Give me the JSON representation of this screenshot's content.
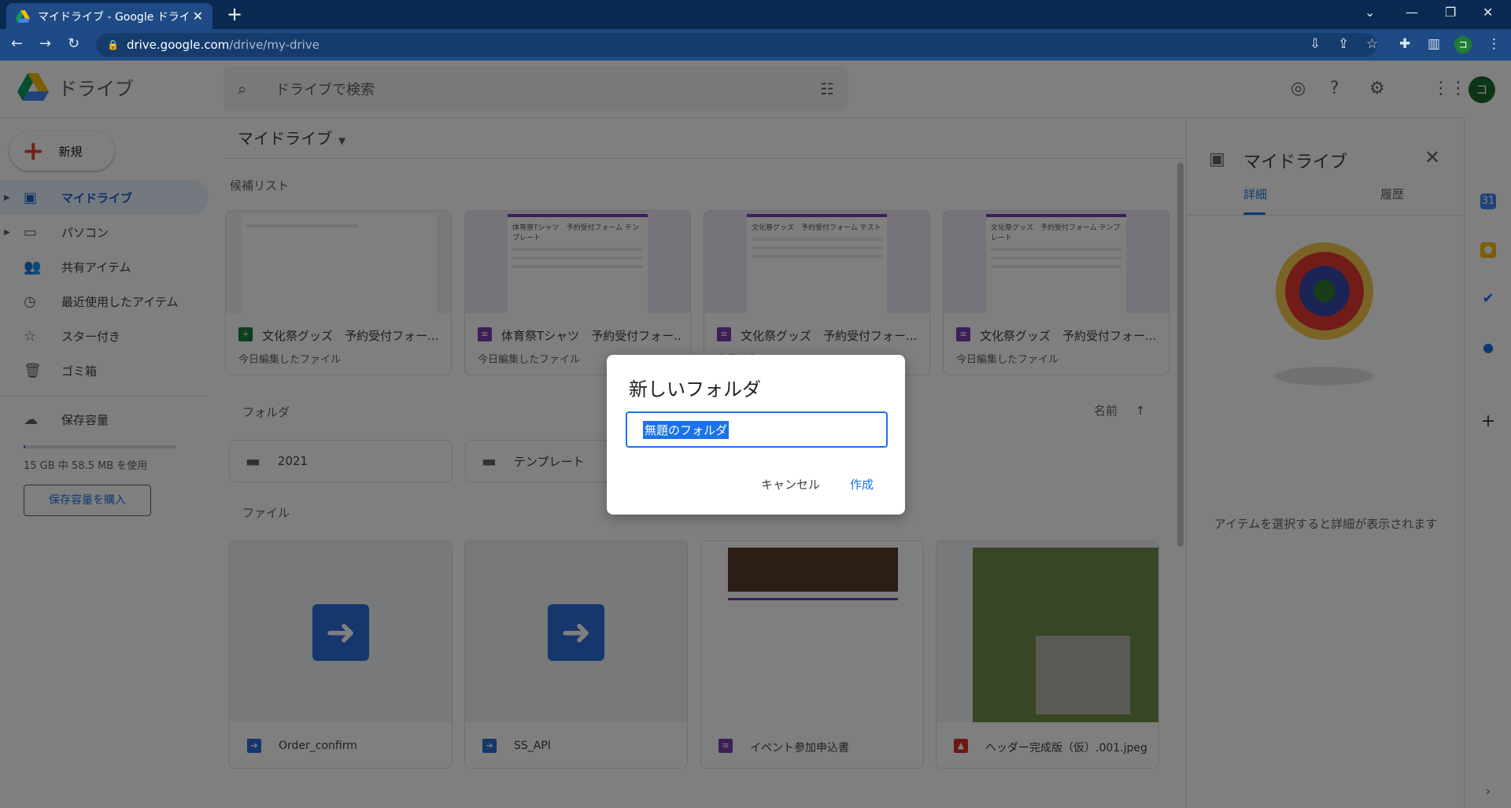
{
  "browser": {
    "tab_title": "マイドライブ - Google ドライブ",
    "url_host": "drive.google.com",
    "url_path": "/drive/my-drive",
    "profile_initial": "コ"
  },
  "header": {
    "app_name": "ドライブ",
    "search_placeholder": "ドライブで検索",
    "avatar_initial": "コ"
  },
  "sidebar": {
    "new_label": "新規",
    "items": [
      {
        "label": "マイドライブ",
        "icon": "drive-icon"
      },
      {
        "label": "パソコン",
        "icon": "computer-icon"
      },
      {
        "label": "共有アイテム",
        "icon": "people-icon"
      },
      {
        "label": "最近使用したアイテム",
        "icon": "clock-icon"
      },
      {
        "label": "スター付き",
        "icon": "star-icon"
      },
      {
        "label": "ゴミ箱",
        "icon": "trash-icon"
      }
    ],
    "storage_label": "保存容量",
    "storage_used_text": "15 GB 中 58.5 MB を使用",
    "storage_fraction": 0.004,
    "buy_storage_label": "保存容量を購入"
  },
  "main": {
    "breadcrumb": "マイドライブ",
    "suggested_label": "候補リスト",
    "suggested": [
      {
        "title": "文化祭グッズ　予約受付フォー...",
        "sub": "今日編集したファイル",
        "type": "sheets",
        "doc_title": ""
      },
      {
        "title": "体育祭Tシャツ　予約受付フォー...",
        "sub": "今日編集したファイル",
        "type": "forms",
        "doc_title": "体育祭Tシャツ　予約受付フォーム テンプレート"
      },
      {
        "title": "文化祭グッズ　予約受付フォー...",
        "sub": "今日編集したファイル",
        "type": "forms",
        "doc_title": "文化祭グッズ　予約受付フォーム テスト"
      },
      {
        "title": "文化祭グッズ　予約受付フォー...",
        "sub": "今日編集したファイル",
        "type": "forms",
        "doc_title": "文化祭グッズ　予約受付フォーム テンプレート"
      }
    ],
    "folders_label": "フォルダ",
    "sort_label": "名前",
    "folders": [
      {
        "name": "2021"
      },
      {
        "name": "テンプレート"
      }
    ],
    "files_label": "ファイル",
    "files": [
      {
        "name": "Order_confirm",
        "type": "apps-script"
      },
      {
        "name": "SS_API",
        "type": "apps-script"
      },
      {
        "name": "イベント参加申込書",
        "type": "forms"
      },
      {
        "name": "ヘッダー完成版（仮）.001.jpeg",
        "type": "image"
      }
    ]
  },
  "details": {
    "title": "マイドライブ",
    "tab_details": "詳細",
    "tab_history": "履歴",
    "empty_text": "アイテムを選択すると詳細が表示されます"
  },
  "dialog": {
    "title": "新しいフォルダ",
    "input_value": "無題のフォルダ",
    "cancel_label": "キャンセル",
    "create_label": "作成"
  },
  "colors": {
    "accent": "#1a73e8",
    "forms": "#7b3fb1",
    "sheets": "#188038",
    "apps_script": "#2a6fd6",
    "image": "#d93025"
  }
}
